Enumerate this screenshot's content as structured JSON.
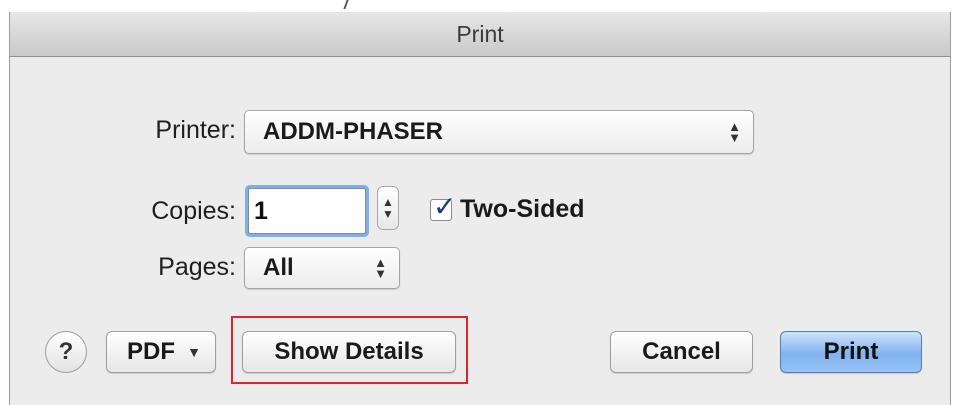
{
  "window": {
    "title": "Print"
  },
  "printer": {
    "label": "Printer:",
    "value": "ADDM-PHASER"
  },
  "copies": {
    "label": "Copies:",
    "value": "1"
  },
  "two_sided": {
    "label": "Two-Sided",
    "checked": true
  },
  "pages": {
    "label": "Pages:",
    "value": "All"
  },
  "buttons": {
    "help": "?",
    "pdf": "PDF",
    "show_details": "Show Details",
    "cancel": "Cancel",
    "print": "Print"
  },
  "icons": {
    "popup_arrows": "up-down-chevron-icon",
    "pdf_arrow": "triangle-down-icon",
    "checkmark": "checkmark-icon"
  },
  "colors": {
    "accent": "#7fb2ef",
    "highlight": "#e0242c",
    "focus_ring": "#7eb0ea"
  }
}
